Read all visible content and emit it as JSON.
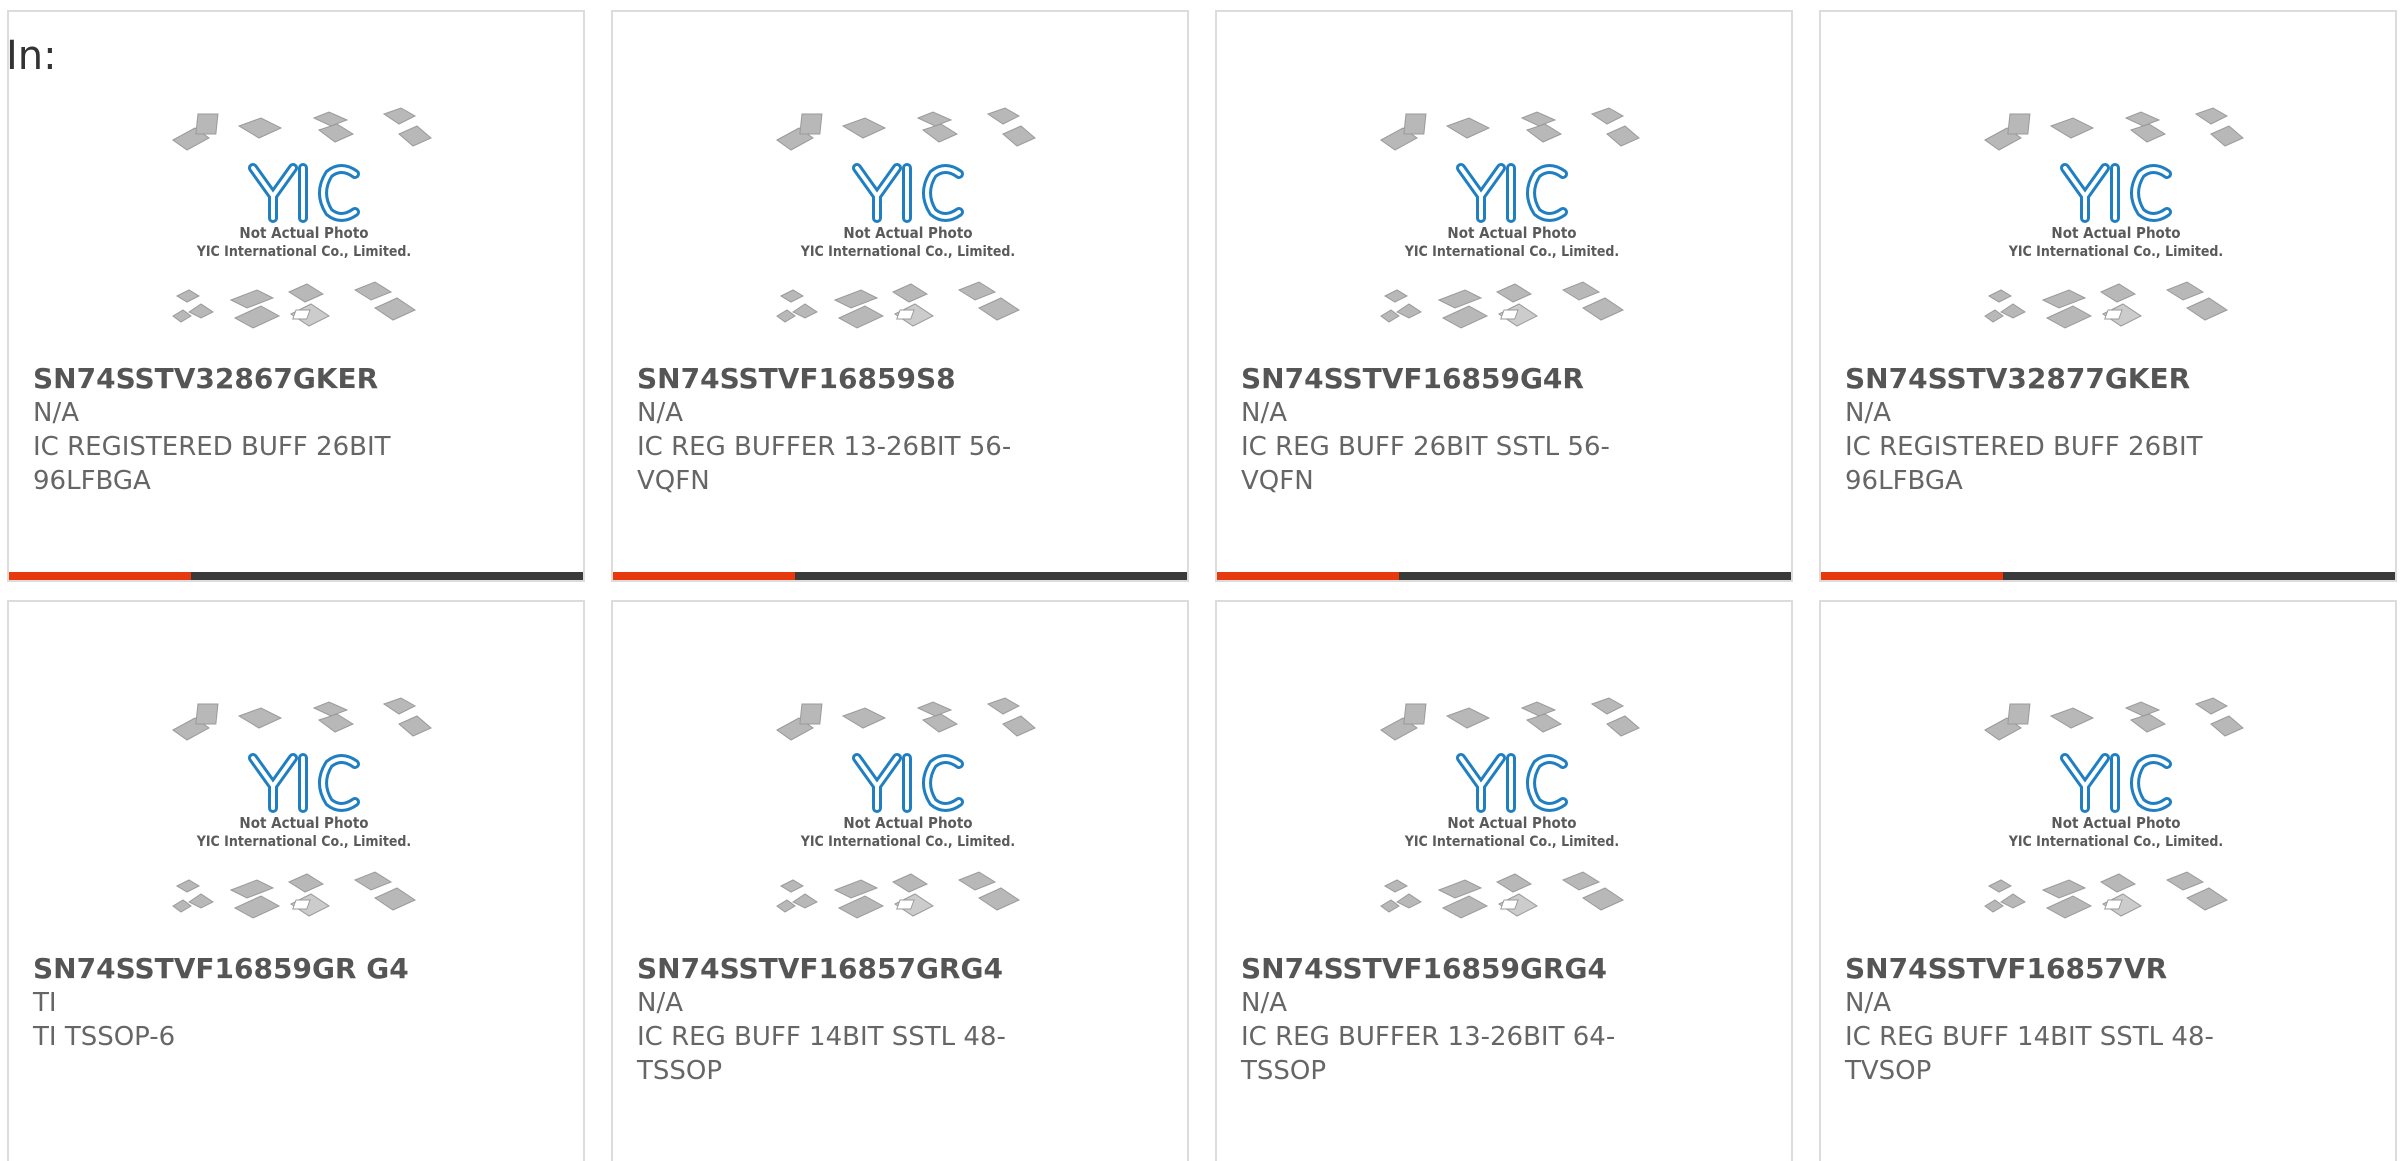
{
  "header": {
    "label": "In:"
  },
  "photo": {
    "logo_text": "YIC",
    "caption_line1": "Not Actual Photo",
    "caption_line2": "YIC International Co., Limited."
  },
  "colors": {
    "accent": "#e8380d",
    "bar_dark": "#3a3a3a",
    "logo_blue": "#1f7fc2"
  },
  "products": [
    {
      "part_number": "SN74SSTV32867GKER",
      "manufacturer": "N/A",
      "description": "IC REGISTERED BUFF 26BIT 96LFBGA"
    },
    {
      "part_number": "SN74SSTVF16859S8",
      "manufacturer": "N/A",
      "description": "IC REG BUFFER 13-26BIT 56-VQFN"
    },
    {
      "part_number": "SN74SSTVF16859G4R",
      "manufacturer": "N/A",
      "description": "IC REG BUFF 26BIT SSTL 56-VQFN"
    },
    {
      "part_number": "SN74SSTV32877GKER",
      "manufacturer": "N/A",
      "description": "IC REGISTERED BUFF 26BIT 96LFBGA"
    },
    {
      "part_number": "SN74SSTVF16859GR G4",
      "manufacturer": "TI",
      "description": "TI TSSOP-6"
    },
    {
      "part_number": "SN74SSTVF16857GRG4",
      "manufacturer": "N/A",
      "description": "IC REG BUFF 14BIT SSTL 48-TSSOP"
    },
    {
      "part_number": "SN74SSTVF16859GRG4",
      "manufacturer": "N/A",
      "description": "IC REG BUFFER 13-26BIT 64-TSSOP"
    },
    {
      "part_number": "SN74SSTVF16857VR",
      "manufacturer": "N/A",
      "description": "IC REG BUFF 14BIT SSTL 48-TVSOP"
    }
  ]
}
